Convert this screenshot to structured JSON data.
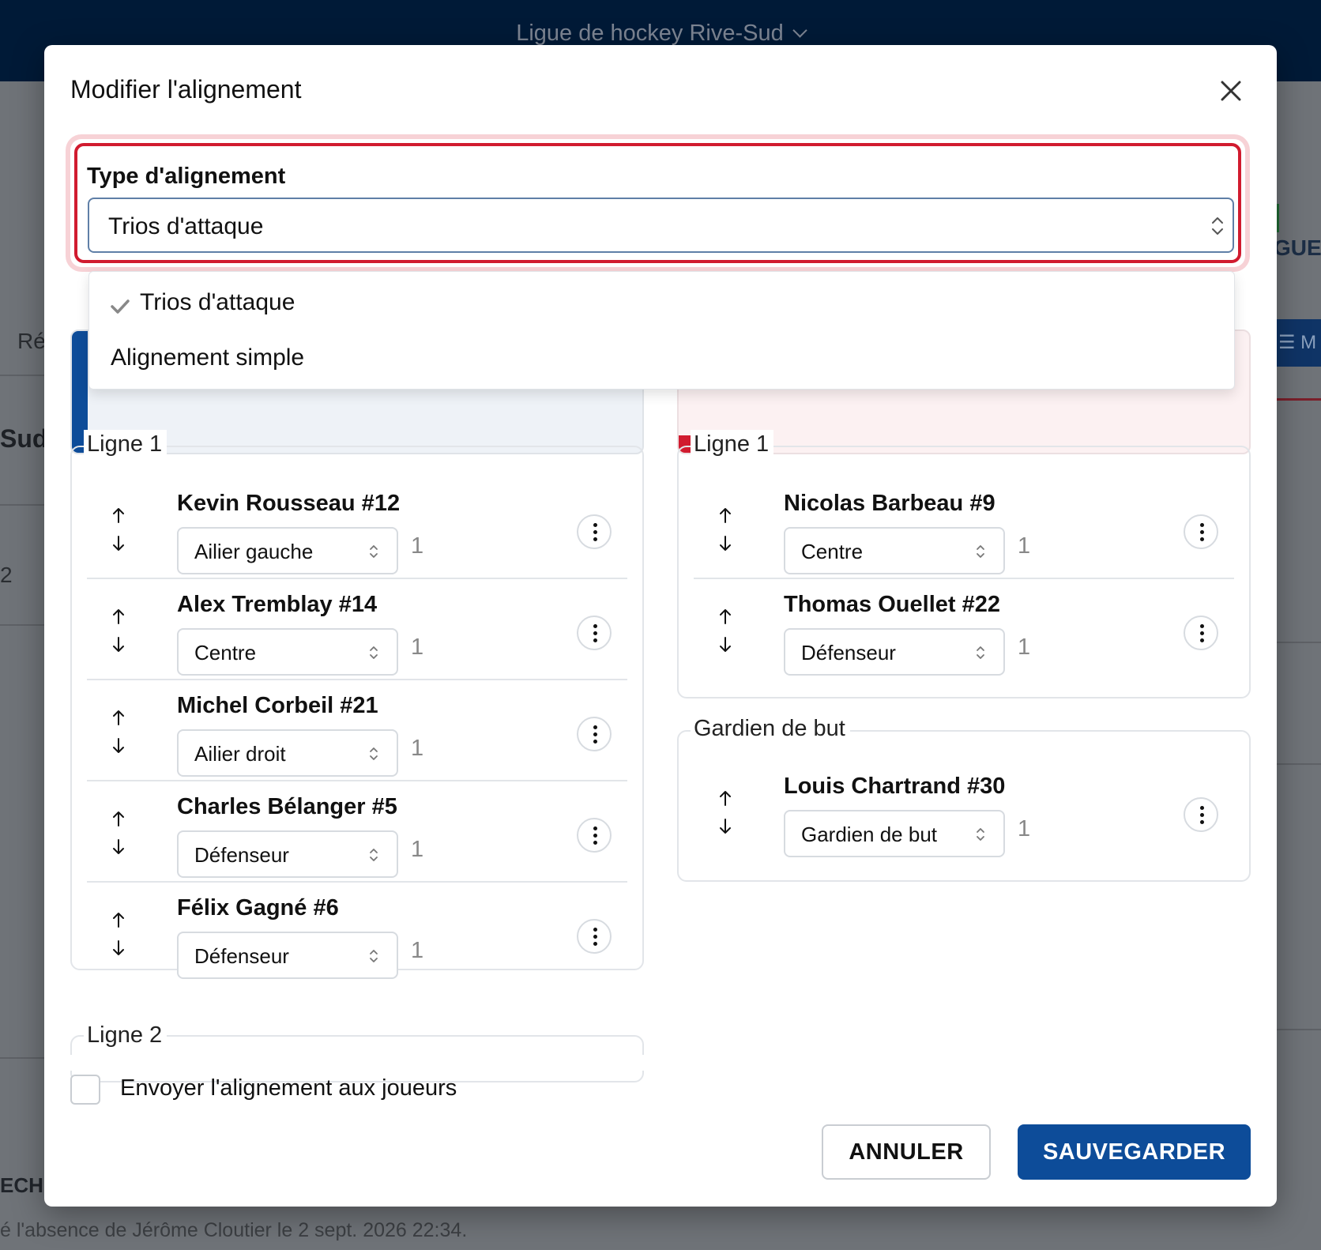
{
  "background": {
    "league_name": "Ligue de hockey Rive-Sud",
    "frag_re": "Ré",
    "frag_sud": "Sud",
    "frag_2": "2",
    "frag_gue": "GUE",
    "frag_nav": "☰ M",
    "frag_ech": "ECHI",
    "footer_text": "é l'absence de Jérôme Cloutier le 2 sept. 2026 22:34."
  },
  "modal": {
    "title": "Modifier l'alignement",
    "type_label": "Type d'alignement",
    "type_value": "Trios d'attaque",
    "dropdown_options": [
      {
        "label": "Trios d'attaque",
        "selected": true
      },
      {
        "label": "Alignement simple",
        "selected": false
      }
    ],
    "left": {
      "groups": [
        {
          "legend": "Ligne 1",
          "players": [
            {
              "name": "Kevin Rousseau #12",
              "position": "Ailier gauche",
              "line": "1"
            },
            {
              "name": "Alex Tremblay #14",
              "position": "Centre",
              "line": "1"
            },
            {
              "name": "Michel Corbeil #21",
              "position": "Ailier droit",
              "line": "1"
            },
            {
              "name": "Charles Bélanger #5",
              "position": "Défenseur",
              "line": "1"
            },
            {
              "name": "Félix Gagné #6",
              "position": "Défenseur",
              "line": "1"
            }
          ]
        },
        {
          "legend": "Ligne 2",
          "players": []
        }
      ]
    },
    "right": {
      "groups": [
        {
          "legend": "Ligne 1",
          "players": [
            {
              "name": "Nicolas Barbeau #9",
              "position": "Centre",
              "line": "1"
            },
            {
              "name": "Thomas Ouellet #22",
              "position": "Défenseur",
              "line": "1"
            }
          ]
        },
        {
          "legend": "Gardien de but",
          "players": [
            {
              "name": "Louis Chartrand #30",
              "position": "Gardien de but",
              "line": "1"
            }
          ]
        }
      ]
    },
    "send_label": "Envoyer l'alignement aux joueurs",
    "cancel_label": "ANNULER",
    "save_label": "SAUVEGARDER"
  },
  "colors": {
    "primary": "#0d4c99",
    "danger": "#d11b2f",
    "topbar": "#001a37"
  },
  "icons": {
    "close": "close-icon",
    "select": "chevron-up-down-icon",
    "check": "check-icon",
    "move_up": "arrow-up-icon",
    "move_down": "arrow-down-icon",
    "more": "more-vertical-icon"
  }
}
